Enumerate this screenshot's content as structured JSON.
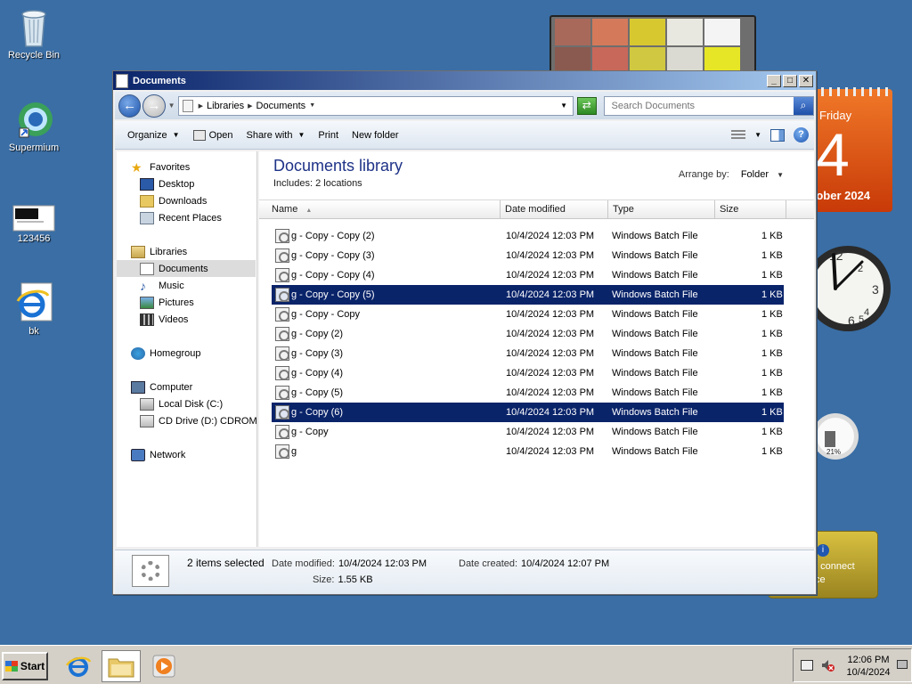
{
  "desktop": {
    "icons": [
      {
        "label": "Recycle Bin"
      },
      {
        "label": "Supermium"
      },
      {
        "label": "123456"
      },
      {
        "label": "bk"
      }
    ]
  },
  "gadgets": {
    "calendar": {
      "day_name": "Friday",
      "day_number": "4",
      "month": "tober 2024"
    },
    "cpu": {
      "percent": "21%"
    },
    "weather": {
      "line1": ": connect",
      "line2": "ce"
    }
  },
  "window": {
    "title": "Documents",
    "buttons": {
      "minimize": "_",
      "maximize": "□",
      "close": "✕"
    },
    "address": {
      "crumbs": [
        "Libraries",
        "Documents"
      ]
    },
    "search": {
      "placeholder": "Search Documents"
    },
    "toolbar": {
      "organize": "Organize",
      "open": "Open",
      "share_with": "Share with",
      "print": "Print",
      "new_folder": "New folder"
    },
    "nav": {
      "favorites": "Favorites",
      "desktop": "Desktop",
      "downloads": "Downloads",
      "recent_places": "Recent Places",
      "libraries": "Libraries",
      "documents": "Documents",
      "music": "Music",
      "pictures": "Pictures",
      "videos": "Videos",
      "homegroup": "Homegroup",
      "computer": "Computer",
      "local_disk": "Local Disk (C:)",
      "cd_drive": "CD Drive (D:) CDROM",
      "network": "Network"
    },
    "library": {
      "title": "Documents library",
      "includes_label": "Includes:",
      "includes_value": "2 locations",
      "arrange_label": "Arrange by:",
      "arrange_value": "Folder"
    },
    "columns": {
      "name": "Name",
      "date_modified": "Date modified",
      "type": "Type",
      "size": "Size"
    },
    "files": [
      {
        "name": "g - Copy - Copy (2)",
        "date": "10/4/2024 12:03 PM",
        "type": "Windows Batch File",
        "size": "1 KB",
        "selected": false
      },
      {
        "name": "g - Copy - Copy (3)",
        "date": "10/4/2024 12:03 PM",
        "type": "Windows Batch File",
        "size": "1 KB",
        "selected": false
      },
      {
        "name": "g - Copy - Copy (4)",
        "date": "10/4/2024 12:03 PM",
        "type": "Windows Batch File",
        "size": "1 KB",
        "selected": false
      },
      {
        "name": "g - Copy - Copy (5)",
        "date": "10/4/2024 12:03 PM",
        "type": "Windows Batch File",
        "size": "1 KB",
        "selected": true
      },
      {
        "name": "g - Copy - Copy",
        "date": "10/4/2024 12:03 PM",
        "type": "Windows Batch File",
        "size": "1 KB",
        "selected": false
      },
      {
        "name": "g - Copy (2)",
        "date": "10/4/2024 12:03 PM",
        "type": "Windows Batch File",
        "size": "1 KB",
        "selected": false
      },
      {
        "name": "g - Copy (3)",
        "date": "10/4/2024 12:03 PM",
        "type": "Windows Batch File",
        "size": "1 KB",
        "selected": false
      },
      {
        "name": "g - Copy (4)",
        "date": "10/4/2024 12:03 PM",
        "type": "Windows Batch File",
        "size": "1 KB",
        "selected": false
      },
      {
        "name": "g - Copy (5)",
        "date": "10/4/2024 12:03 PM",
        "type": "Windows Batch File",
        "size": "1 KB",
        "selected": false
      },
      {
        "name": "g - Copy (6)",
        "date": "10/4/2024 12:03 PM",
        "type": "Windows Batch File",
        "size": "1 KB",
        "selected": true
      },
      {
        "name": "g - Copy",
        "date": "10/4/2024 12:03 PM",
        "type": "Windows Batch File",
        "size": "1 KB",
        "selected": false
      },
      {
        "name": "g",
        "date": "10/4/2024 12:03 PM",
        "type": "Windows Batch File",
        "size": "1 KB",
        "selected": false
      }
    ],
    "details": {
      "selection": "2 items selected",
      "date_modified_label": "Date modified:",
      "date_modified_value": "10/4/2024 12:03 PM",
      "date_created_label": "Date created:",
      "date_created_value": "10/4/2024 12:07 PM",
      "size_label": "Size:",
      "size_value": "1.55 KB"
    }
  },
  "taskbar": {
    "start": "Start",
    "clock_time": "12:06 PM",
    "clock_date": "10/4/2024"
  },
  "colors": {
    "desktop": "#3a6ea5",
    "selection": "#0a246a",
    "title_start": "#0a246a",
    "title_end": "#a6caf0",
    "library_title": "#1e3287"
  }
}
